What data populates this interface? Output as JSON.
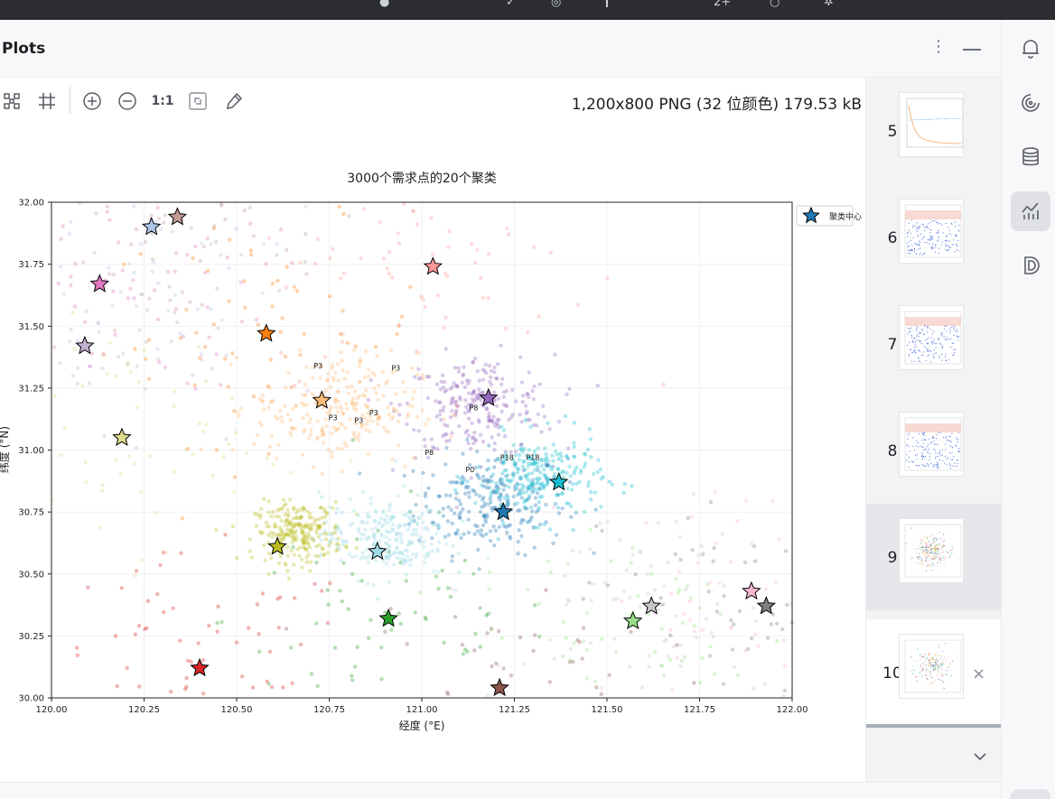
{
  "window": {
    "panel_title": "Plots"
  },
  "header": {
    "more_icon": "more-vertical-icon",
    "minimize_icon": "minimize-icon"
  },
  "toolbar": {
    "tools": [
      {
        "name": "fit-grid-icon"
      },
      {
        "name": "grid-icon"
      },
      {
        "name": "zoom-in-icon"
      },
      {
        "name": "zoom-out-icon"
      },
      {
        "name": "actual-size",
        "label": "1:1"
      },
      {
        "name": "fit-window-icon"
      },
      {
        "name": "color-picker-icon"
      }
    ],
    "image_info": "1,200x800 PNG (32 位颜色) 179.53 kB"
  },
  "thumbnails": [
    {
      "number": "5"
    },
    {
      "number": "6"
    },
    {
      "number": "7"
    },
    {
      "number": "8"
    },
    {
      "number": "9"
    },
    {
      "number": "10",
      "close": "×"
    }
  ],
  "sidebar": {
    "items": [
      {
        "name": "notifications-icon"
      },
      {
        "name": "ai-assistant-icon"
      },
      {
        "name": "database-icon"
      },
      {
        "name": "sciview-plots-icon",
        "active": true
      },
      {
        "name": "dataspell-icon"
      }
    ]
  },
  "chart_data": {
    "type": "scatter",
    "title": "3000个需求点的20个聚类",
    "xlabel": "经度 (°E)",
    "ylabel": "纬度 (°N)",
    "xlim": [
      120.0,
      122.0
    ],
    "ylim": [
      30.0,
      32.0
    ],
    "xticks": [
      "120.00",
      "120.25",
      "120.50",
      "120.75",
      "121.00",
      "121.25",
      "121.50",
      "121.75",
      "122.00"
    ],
    "yticks": [
      "30.00",
      "30.25",
      "30.50",
      "30.75",
      "31.00",
      "31.25",
      "31.50",
      "31.75",
      "32.00"
    ],
    "grid": true,
    "legend": {
      "position": "upper-right-outside",
      "label": "聚类中心"
    },
    "centers": [
      {
        "x": 121.22,
        "y": 30.75,
        "color": "#1f77b4"
      },
      {
        "x": 120.58,
        "y": 31.47,
        "color": "#ff7f0e"
      },
      {
        "x": 120.91,
        "y": 30.32,
        "color": "#2ca02c"
      },
      {
        "x": 120.4,
        "y": 30.12,
        "color": "#d62728"
      },
      {
        "x": 121.18,
        "y": 31.21,
        "color": "#9467bd"
      },
      {
        "x": 121.21,
        "y": 30.04,
        "color": "#8c564b"
      },
      {
        "x": 120.13,
        "y": 31.67,
        "color": "#e377c2"
      },
      {
        "x": 121.93,
        "y": 30.37,
        "color": "#7f7f7f"
      },
      {
        "x": 120.61,
        "y": 30.61,
        "color": "#bcbd22"
      },
      {
        "x": 121.37,
        "y": 30.87,
        "color": "#17becf"
      },
      {
        "x": 120.27,
        "y": 31.9,
        "color": "#aec7e8"
      },
      {
        "x": 120.73,
        "y": 31.2,
        "color": "#ffbb78"
      },
      {
        "x": 121.57,
        "y": 30.31,
        "color": "#98df8a"
      },
      {
        "x": 121.03,
        "y": 31.74,
        "color": "#ff9896"
      },
      {
        "x": 120.09,
        "y": 31.42,
        "color": "#c5b0d5"
      },
      {
        "x": 120.34,
        "y": 31.94,
        "color": "#c49c94"
      },
      {
        "x": 121.89,
        "y": 30.43,
        "color": "#f7b6d2"
      },
      {
        "x": 121.62,
        "y": 30.37,
        "color": "#c7c7c7"
      },
      {
        "x": 120.19,
        "y": 31.05,
        "color": "#dbdb8d"
      },
      {
        "x": 120.88,
        "y": 30.59,
        "color": "#9edae5"
      }
    ],
    "annotations": [
      {
        "x": 120.72,
        "y": 31.33,
        "text": "P3"
      },
      {
        "x": 120.93,
        "y": 31.32,
        "text": "P3"
      },
      {
        "x": 120.76,
        "y": 31.12,
        "text": "P3"
      },
      {
        "x": 120.83,
        "y": 31.11,
        "text": "P3"
      },
      {
        "x": 120.87,
        "y": 31.14,
        "text": "P3"
      },
      {
        "x": 121.14,
        "y": 31.16,
        "text": "P8"
      },
      {
        "x": 121.02,
        "y": 30.98,
        "text": "P8"
      },
      {
        "x": 121.13,
        "y": 30.91,
        "text": "P0"
      },
      {
        "x": 121.23,
        "y": 30.96,
        "text": "P18"
      },
      {
        "x": 121.3,
        "y": 30.96,
        "text": "P18"
      }
    ],
    "points_per_cluster_approx": 150
  }
}
